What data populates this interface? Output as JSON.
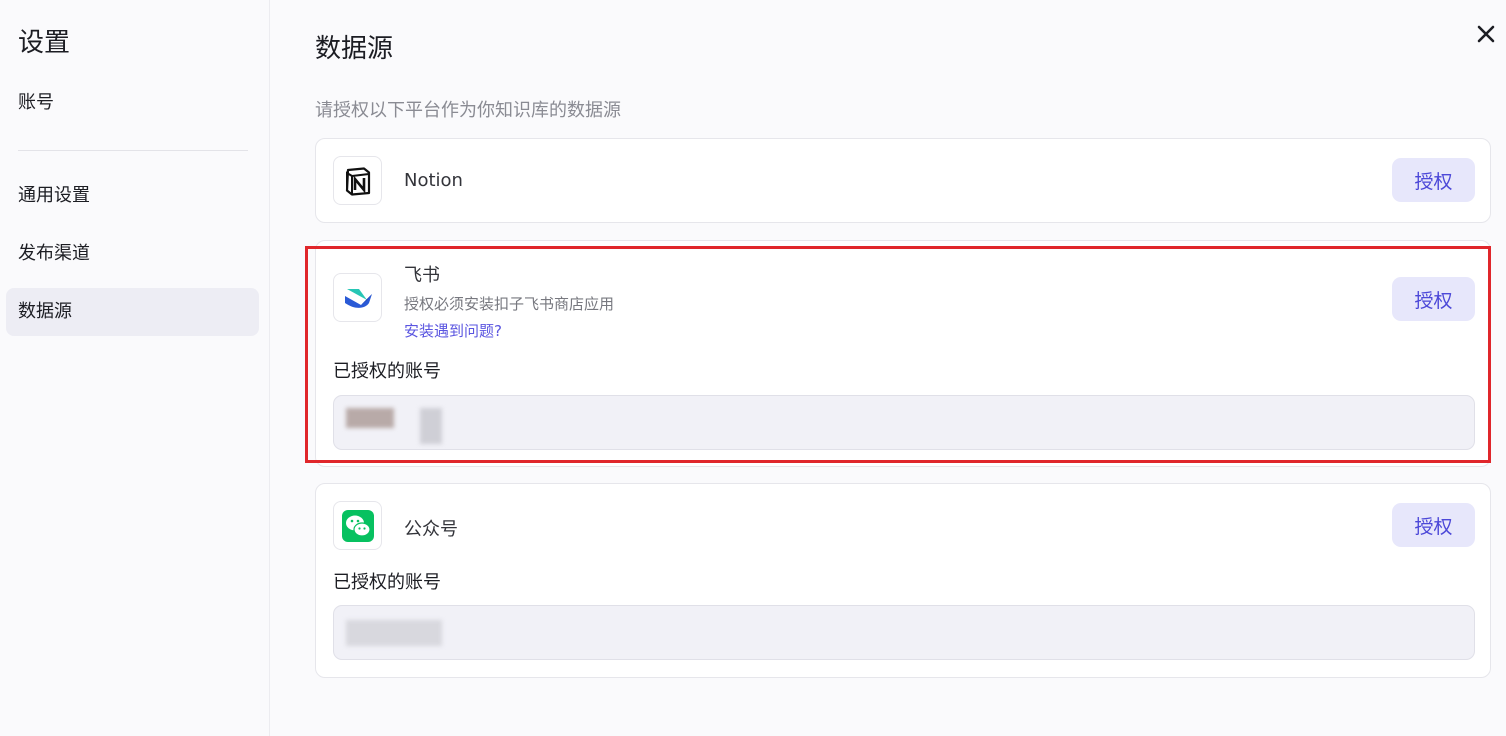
{
  "sidebar": {
    "title": "设置",
    "items": [
      {
        "label": "账号"
      },
      {
        "label": "通用设置"
      },
      {
        "label": "发布渠道"
      },
      {
        "label": "数据源",
        "active": true
      }
    ]
  },
  "main": {
    "title": "数据源",
    "subtitle": "请授权以下平台作为你知识库的数据源",
    "sources": [
      {
        "name": "Notion",
        "icon": "notion-icon",
        "button": "授权"
      },
      {
        "name": "飞书",
        "icon": "feishu-icon",
        "description": "授权必须安装扣子飞书商店应用",
        "link": "安装遇到问题?",
        "button": "授权",
        "accounts_label": "已授权的账号"
      },
      {
        "name": "公众号",
        "icon": "wechat-icon",
        "button": "授权",
        "accounts_label": "已授权的账号"
      }
    ]
  },
  "colors": {
    "accent": "#4c48d8",
    "button_bg": "#e7e7fb",
    "highlight": "#e0262b",
    "wechat": "#07c160"
  }
}
